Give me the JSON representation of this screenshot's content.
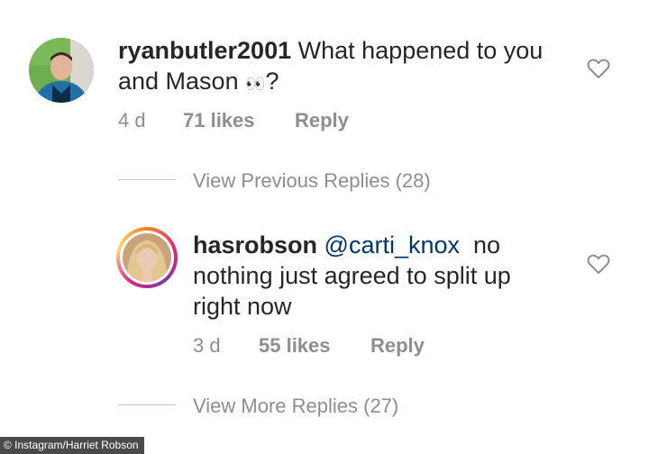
{
  "comment1": {
    "username": "ryanbutler2001",
    "text_line1": "What happened to you",
    "text_line2": "and Mason",
    "emoji": "👀",
    "text_end": "?",
    "time": "4 d",
    "likes": "71 likes",
    "reply_label": "Reply"
  },
  "view_previous": "View Previous Replies (28)",
  "comment2": {
    "username": "hasrobson",
    "mention": "@carti_knox",
    "text_part1": "no",
    "text_line2": "nothing just agreed to split up",
    "text_line3": "right now",
    "time": "3 d",
    "likes": "55 likes",
    "reply_label": "Reply"
  },
  "view_more": "View More Replies (27)",
  "credit": "© Instagram/Harriet Robson",
  "colors": {
    "heart_stroke": "#8e8e8e",
    "text": "#262626",
    "meta": "#8e8e8e"
  },
  "icons": {
    "like": "heart-outline-icon"
  }
}
